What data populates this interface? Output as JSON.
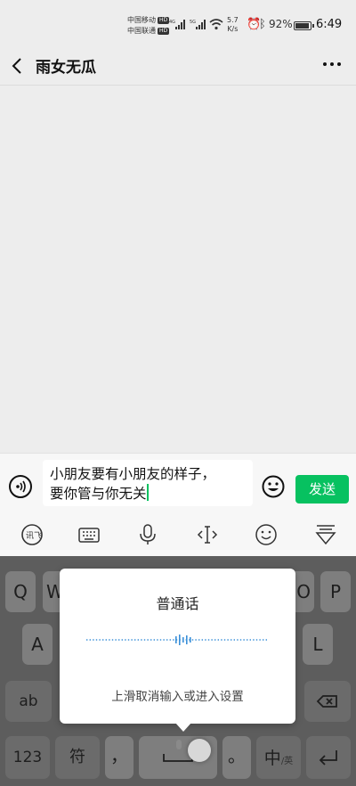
{
  "status_bar": {
    "carrier1": "中国移动",
    "carrier2": "中国联通",
    "hd": "HD",
    "net1": "4G",
    "net2": "5G",
    "speed_value": "5.7",
    "speed_unit": "K/s",
    "battery": "92%",
    "time": "6:49"
  },
  "header": {
    "title": "雨女无瓜",
    "back_icon": "chevron-left-icon",
    "more_icon": "ellipsis-icon"
  },
  "input": {
    "text_line1": "小朋友要有小朋友的样子，",
    "text_line2": "要你管与你无关",
    "send_label": "发送",
    "accent": "#07c160"
  },
  "kb_toolbar": {
    "items": [
      "iflytek-icon",
      "keyboard-icon",
      "microphone-icon",
      "cursor-icon",
      "emoji-icon",
      "collapse-icon"
    ]
  },
  "keyboard": {
    "row1": [
      "Q",
      "W",
      "O",
      "P"
    ],
    "row2": [
      "A",
      "L"
    ],
    "row3_left": "ab",
    "bottom": {
      "num": "123",
      "sym": "符",
      "comma": "，",
      "period": "。",
      "lang_main": "中",
      "lang_sub": "/英"
    }
  },
  "voice_overlay": {
    "title": "普通话",
    "hint": "上滑取消输入或进入设置"
  }
}
